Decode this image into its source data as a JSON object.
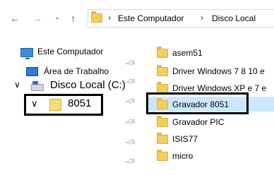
{
  "nav": {
    "back_icon": "arrow-left",
    "forward_icon": "arrow-right",
    "recent_icon": "chevron-down",
    "up_icon": "arrow-up"
  },
  "address": {
    "separator": "›",
    "crumbs": [
      "Este Computador",
      "Disco Local"
    ]
  },
  "tree": {
    "items": [
      {
        "label": "Este Computador",
        "icon": "computer-icon"
      },
      {
        "label": "Área de Trabalho",
        "icon": "desktop-icon"
      },
      {
        "label": "Disco Local (C:)",
        "icon": "drive-icon"
      },
      {
        "label": "8051",
        "icon": "folder-icon"
      }
    ]
  },
  "files": [
    {
      "label": "asem51"
    },
    {
      "label": "Driver Windows 7 8 10 e"
    },
    {
      "label": "Driver Windows XP e 7 e"
    },
    {
      "label": "Gravador 8051"
    },
    {
      "label": "Gravador PIC"
    },
    {
      "label": "ISIS77"
    },
    {
      "label": "micro"
    }
  ]
}
